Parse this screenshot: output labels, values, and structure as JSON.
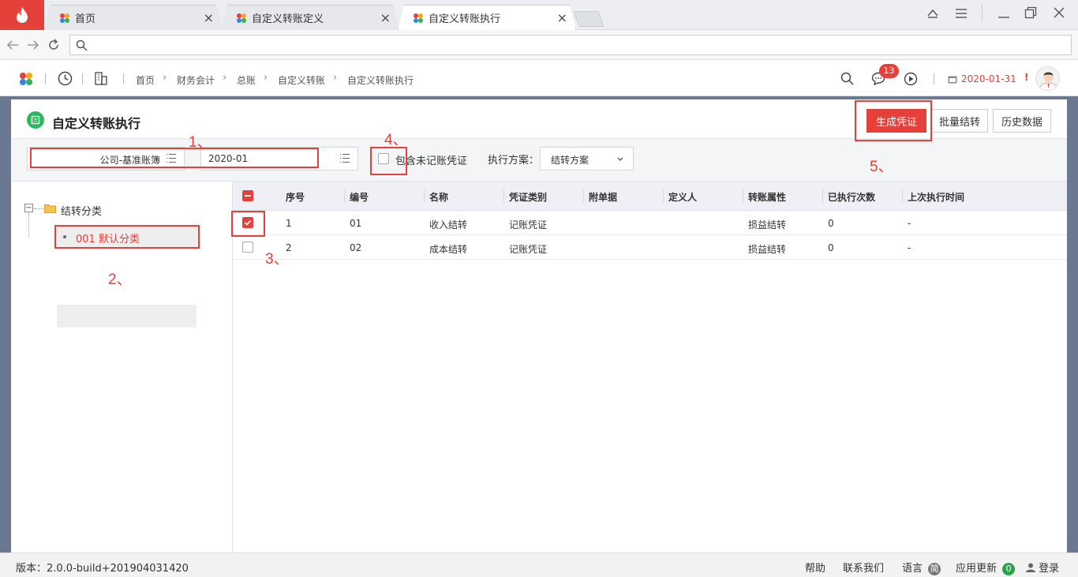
{
  "browser": {
    "tabs": [
      {
        "label": "首页"
      },
      {
        "label": "自定义转账定义"
      },
      {
        "label": "自定义转账执行"
      }
    ],
    "tab_close": "×"
  },
  "header": {
    "breadcrumb": [
      "首页",
      "财务会计",
      "总账",
      "自定义转账",
      "自定义转账执行"
    ],
    "message_count": "13",
    "date": "2020-01-31",
    "alert_mark": "!"
  },
  "page": {
    "title": "自定义转账执行",
    "buttons": {
      "generate": "生成凭证",
      "batch": "批量结转",
      "history": "历史数据"
    }
  },
  "filters": {
    "account_book": "公司-基准账簿",
    "period": "2020-01",
    "include_unposted_label": "包含未记账凭证",
    "include_unposted_checked": false,
    "plan_label": "执行方案：",
    "plan_value": "结转方案"
  },
  "tree": {
    "root_toggle": "−",
    "root": "结转分类",
    "child": "001 默认分类"
  },
  "grid": {
    "columns": [
      "序号",
      "编号",
      "名称",
      "凭证类别",
      "附单据",
      "定义人",
      "转账属性",
      "已执行次数",
      "上次执行时间"
    ],
    "rows": [
      {
        "seq": "1",
        "code": "01",
        "name": "收入结转",
        "voucher_type": "记账凭证",
        "attachments": "",
        "definer": "",
        "attribute": "损益结转",
        "exec_count": "0",
        "last_exec": "-",
        "checked": true
      },
      {
        "seq": "2",
        "code": "02",
        "name": "成本结转",
        "voucher_type": "记账凭证",
        "attachments": "",
        "definer": "",
        "attribute": "损益结转",
        "exec_count": "0",
        "last_exec": "-",
        "checked": false
      }
    ]
  },
  "annotations": {
    "a1": "1、",
    "a2": "2、",
    "a3": "3、",
    "a4": "4、",
    "a5": "5、"
  },
  "footer": {
    "version": "版本：2.0.0-build+201904031420",
    "help": "帮助",
    "contact": "联系我们",
    "language": "语言",
    "language_badge": "简",
    "updates": "应用更新",
    "updates_count": "0",
    "login": "登录"
  },
  "colors": {
    "accent": "#e5403a",
    "workspace_bg": "#6b7892",
    "badge_green": "#2aa34a"
  }
}
